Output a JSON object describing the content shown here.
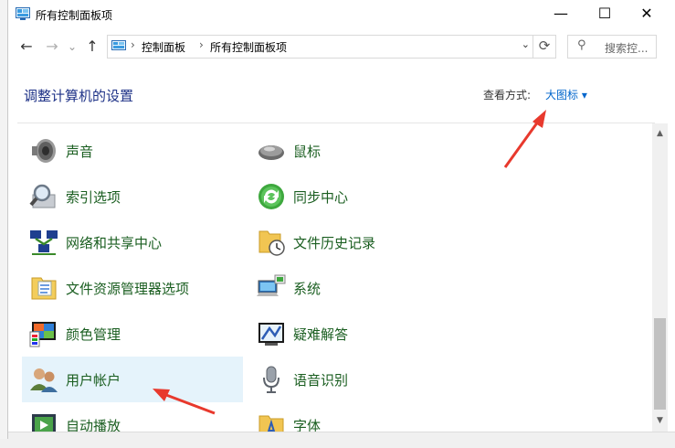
{
  "window": {
    "title": "所有控制面板项",
    "minimize": "—",
    "maximize": "☐",
    "close": "✕"
  },
  "nav": {
    "back": "←",
    "forward": "→",
    "recent": "⌄",
    "up": "↑",
    "breadcrumb": [
      "控制面板",
      "所有控制面板项"
    ],
    "refresh": "⟳",
    "search_placeholder": "搜索控..."
  },
  "main": {
    "heading": "调整计算机的设置",
    "view_label": "查看方式:",
    "view_value": "大图标 ▾"
  },
  "left_items": [
    {
      "label": "声音",
      "icon": "speaker-icon"
    },
    {
      "label": "索引选项",
      "icon": "index-icon"
    },
    {
      "label": "网络和共享中心",
      "icon": "network-icon"
    },
    {
      "label": "文件资源管理器选项",
      "icon": "folder-options-icon"
    },
    {
      "label": "颜色管理",
      "icon": "color-icon"
    },
    {
      "label": "用户帐户",
      "icon": "users-icon"
    },
    {
      "label": "自动播放",
      "icon": "autoplay-icon"
    }
  ],
  "right_items": [
    {
      "label": "鼠标",
      "icon": "mouse-icon"
    },
    {
      "label": "同步中心",
      "icon": "sync-icon"
    },
    {
      "label": "文件历史记录",
      "icon": "file-history-icon"
    },
    {
      "label": "系统",
      "icon": "system-icon"
    },
    {
      "label": "疑难解答",
      "icon": "troubleshoot-icon"
    },
    {
      "label": "语音识别",
      "icon": "microphone-icon"
    },
    {
      "label": "字体",
      "icon": "fonts-icon"
    }
  ],
  "selected_item": "用户帐户",
  "colors": {
    "heading": "#1e3287",
    "link": "#0066cc",
    "item_label": "#1a5e20",
    "selection": "#e5f3fb",
    "annotation_arrow": "#e8392d"
  }
}
